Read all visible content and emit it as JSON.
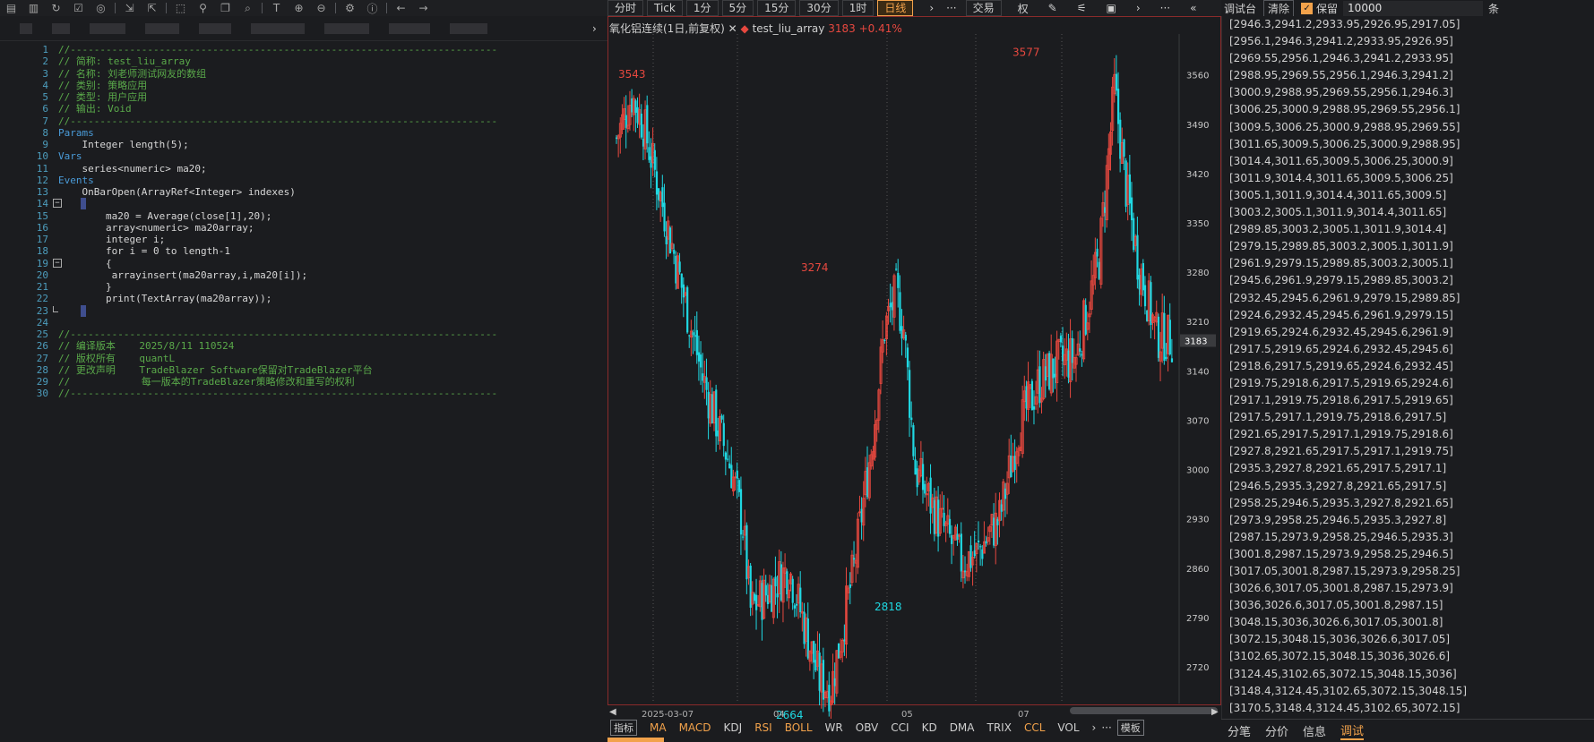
{
  "editor": {
    "lines": [
      {
        "n": "1",
        "t": "//------------------------------------------------------------------------",
        "c": "c-cmt"
      },
      {
        "n": "2",
        "t": "// 简称: test_liu_array",
        "c": "c-cmt"
      },
      {
        "n": "3",
        "t": "// 名称: 刘老师测试网友的数组",
        "c": "c-cmt"
      },
      {
        "n": "4",
        "t": "// 类别: 策略应用",
        "c": "c-cmt"
      },
      {
        "n": "5",
        "t": "// 类型: 用户应用",
        "c": "c-cmt"
      },
      {
        "n": "6",
        "t": "// 输出: Void",
        "c": "c-cmt"
      },
      {
        "n": "7",
        "t": "//------------------------------------------------------------------------",
        "c": "c-cmt"
      },
      {
        "n": "8",
        "t": "Params",
        "c": "c-kw"
      },
      {
        "n": "9",
        "t": "    Integer length(5);",
        "c": "c-pl"
      },
      {
        "n": "10",
        "t": "Vars",
        "c": "c-kw"
      },
      {
        "n": "11",
        "t": "    series<numeric> ma20;",
        "c": "c-pl"
      },
      {
        "n": "12",
        "t": "Events",
        "c": "c-kw"
      },
      {
        "n": "13",
        "t": "    OnBarOpen(ArrayRef<Integer> indexes)",
        "c": "c-pl"
      },
      {
        "n": "14",
        "t": "",
        "c": "c-pl"
      },
      {
        "n": "15",
        "t": "        ma20 = Average(close[1],20);",
        "c": "c-pl"
      },
      {
        "n": "16",
        "t": "        array<numeric> ma20array;",
        "c": "c-pl"
      },
      {
        "n": "17",
        "t": "        integer i;",
        "c": "c-pl"
      },
      {
        "n": "18",
        "t": "        for i = 0 to length-1",
        "c": "c-pl"
      },
      {
        "n": "19",
        "t": "        {",
        "c": "c-pl"
      },
      {
        "n": "20",
        "t": "         arrayinsert(ma20array,i,ma20[i]);",
        "c": "c-pl"
      },
      {
        "n": "21",
        "t": "        }",
        "c": "c-pl"
      },
      {
        "n": "22",
        "t": "        print(TextArray(ma20array));",
        "c": "c-pl"
      },
      {
        "n": "23",
        "t": "",
        "c": "c-pl"
      },
      {
        "n": "24",
        "t": "",
        "c": "c-pl"
      },
      {
        "n": "25",
        "t": "//------------------------------------------------------------------------",
        "c": "c-cmt"
      },
      {
        "n": "26",
        "t": "// 编译版本    2025/8/11 110524",
        "c": "c-cmt"
      },
      {
        "n": "27",
        "t": "// 版权所有    quantL",
        "c": "c-cmt"
      },
      {
        "n": "28",
        "t": "// 更改声明    TradeBlazer Software保留对TradeBlazer平台",
        "c": "c-cmt"
      },
      {
        "n": "29",
        "t": "//            每一版本的TradeBlazer策略修改和重写的权利",
        "c": "c-cmt"
      },
      {
        "n": "30",
        "t": "//------------------------------------------------------------------------",
        "c": "c-cmt"
      }
    ]
  },
  "chart_toolbar": {
    "timeframes": [
      "分时",
      "Tick",
      "1分",
      "5分",
      "15分",
      "30分",
      "1时",
      "日线"
    ],
    "active": "日线",
    "trade": "交易",
    "quan": "权"
  },
  "chart_header": {
    "symbol": "氧化铝连续(1日,前复权)",
    "indicator": "test_liu_array",
    "value": "3183",
    "change": "+0.41%"
  },
  "chart_data": {
    "type": "candlestick",
    "y_ticks": [
      3560,
      3490,
      3420,
      3350,
      3280,
      3210,
      3140,
      3070,
      3000,
      2930,
      2860,
      2790,
      2720
    ],
    "ylim": [
      2668,
      3618
    ],
    "x_labels": [
      "2025-03-07",
      "04",
      "05",
      "07"
    ],
    "last_price": "3183",
    "annotations": [
      {
        "label": "3543",
        "value": 3543,
        "color": "#e7483f"
      },
      {
        "label": "3274",
        "value": 3274,
        "color": "#e7483f"
      },
      {
        "label": "2664",
        "value": 2664,
        "color": "#1fd8e2"
      },
      {
        "label": "2818",
        "value": 2818,
        "color": "#1fd8e2"
      },
      {
        "label": "3577",
        "value": 3577,
        "color": "#e7483f"
      }
    ],
    "up_color": "#e7483f",
    "down_color": "#1fd8e2"
  },
  "indicator_tabs": {
    "label": "指标",
    "items": [
      "MA",
      "MACD",
      "KDJ",
      "RSI",
      "BOLL",
      "WR",
      "OBV",
      "CCI",
      "KD",
      "DMA",
      "TRIX",
      "CCL",
      "VOL"
    ],
    "highlight": [
      "MA",
      "MACD",
      "RSI",
      "BOLL",
      "CCL"
    ],
    "template": "模板"
  },
  "debug": {
    "title": "调试台",
    "clear": "清除",
    "keep": "保留",
    "count": "10000",
    "unit": "条",
    "lines": [
      "[2946.3,2941.2,2933.95,2926.95,2917.05]",
      "[2956.1,2946.3,2941.2,2933.95,2926.95]",
      "[2969.55,2956.1,2946.3,2941.2,2933.95]",
      "[2988.95,2969.55,2956.1,2946.3,2941.2]",
      "[3000.9,2988.95,2969.55,2956.1,2946.3]",
      "[3006.25,3000.9,2988.95,2969.55,2956.1]",
      "[3009.5,3006.25,3000.9,2988.95,2969.55]",
      "[3011.65,3009.5,3006.25,3000.9,2988.95]",
      "[3014.4,3011.65,3009.5,3006.25,3000.9]",
      "[3011.9,3014.4,3011.65,3009.5,3006.25]",
      "[3005.1,3011.9,3014.4,3011.65,3009.5]",
      "[3003.2,3005.1,3011.9,3014.4,3011.65]",
      "[2989.85,3003.2,3005.1,3011.9,3014.4]",
      "[2979.15,2989.85,3003.2,3005.1,3011.9]",
      "[2961.9,2979.15,2989.85,3003.2,3005.1]",
      "[2945.6,2961.9,2979.15,2989.85,3003.2]",
      "[2932.45,2945.6,2961.9,2979.15,2989.85]",
      "[2924.6,2932.45,2945.6,2961.9,2979.15]",
      "[2919.65,2924.6,2932.45,2945.6,2961.9]",
      "[2917.5,2919.65,2924.6,2932.45,2945.6]",
      "[2918.6,2917.5,2919.65,2924.6,2932.45]",
      "[2919.75,2918.6,2917.5,2919.65,2924.6]",
      "[2917.1,2919.75,2918.6,2917.5,2919.65]",
      "[2917.5,2917.1,2919.75,2918.6,2917.5]",
      "[2921.65,2917.5,2917.1,2919.75,2918.6]",
      "[2927.8,2921.65,2917.5,2917.1,2919.75]",
      "[2935.3,2927.8,2921.65,2917.5,2917.1]",
      "[2946.5,2935.3,2927.8,2921.65,2917.5]",
      "[2958.25,2946.5,2935.3,2927.8,2921.65]",
      "[2973.9,2958.25,2946.5,2935.3,2927.8]",
      "[2987.15,2973.9,2958.25,2946.5,2935.3]",
      "[3001.8,2987.15,2973.9,2958.25,2946.5]",
      "[3017.05,3001.8,2987.15,2973.9,2958.25]",
      "[3026.6,3017.05,3001.8,2987.15,2973.9]",
      "[3036,3026.6,3017.05,3001.8,2987.15]",
      "[3048.15,3036,3026.6,3017.05,3001.8]",
      "[3072.15,3048.15,3036,3026.6,3017.05]",
      "[3102.65,3072.15,3048.15,3036,3026.6]",
      "[3124.45,3102.65,3072.15,3048.15,3036]",
      "[3148.4,3124.45,3102.65,3072.15,3048.15]",
      "[3170.5,3148.4,3124.45,3102.65,3072.15]"
    ],
    "tabs": [
      "分笔",
      "分价",
      "信息",
      "调试"
    ],
    "active_tab": "调试"
  }
}
